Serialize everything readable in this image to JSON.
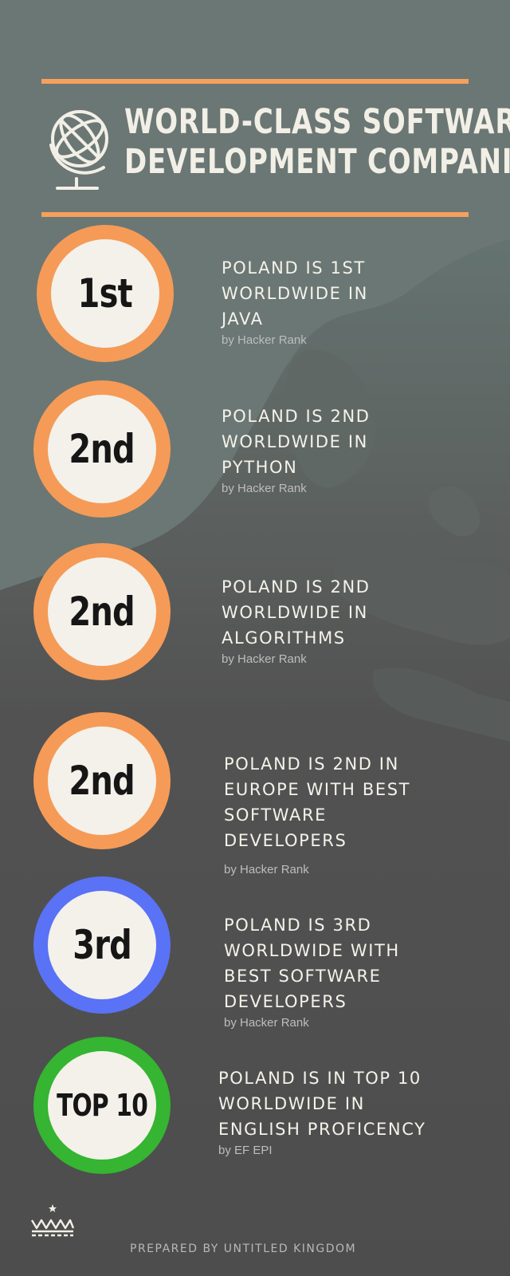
{
  "header": {
    "title_line1": "WORLD-CLASS SOFTWARE",
    "title_line2": "DEVELOPMENT COMPANIES",
    "accent_color": "#f6a05c",
    "icon": "globe-icon"
  },
  "items": [
    {
      "rank": "1st",
      "headline": "POLAND IS 1ST\nWORLDWIDE IN\nJAVA",
      "source": "by Hacker Rank",
      "ring_color": "#f59b57"
    },
    {
      "rank": "2nd",
      "headline": "POLAND IS 2ND\nWORLDWIDE IN\nPYTHON",
      "source": "by Hacker Rank",
      "ring_color": "#f59b57"
    },
    {
      "rank": "2nd",
      "headline": "POLAND IS 2ND\nWORLDWIDE IN\nALGORITHMS",
      "source": "by Hacker Rank",
      "ring_color": "#f59b57"
    },
    {
      "rank": "2nd",
      "headline": "POLAND IS 2ND IN\nEUROPE WITH BEST\nSOFTWARE\nDEVELOPERS",
      "source": "by Hacker Rank",
      "ring_color": "#f59b57"
    },
    {
      "rank": "3rd",
      "headline": "POLAND IS 3RD\nWORLDWIDE WITH\nBEST SOFTWARE\nDEVELOPERS",
      "source": "by Hacker Rank",
      "ring_color": "#5a72f5"
    },
    {
      "rank": "TOP 10",
      "headline": "POLAND IS IN TOP 10\nWORLDWIDE IN\nENGLISH PROFICENCY",
      "source": "by EF EPI",
      "ring_color": "#35b531"
    }
  ],
  "footer": {
    "text": "PREPARED BY UNTITLED KINGDOM",
    "icon": "crown-logo-icon"
  }
}
